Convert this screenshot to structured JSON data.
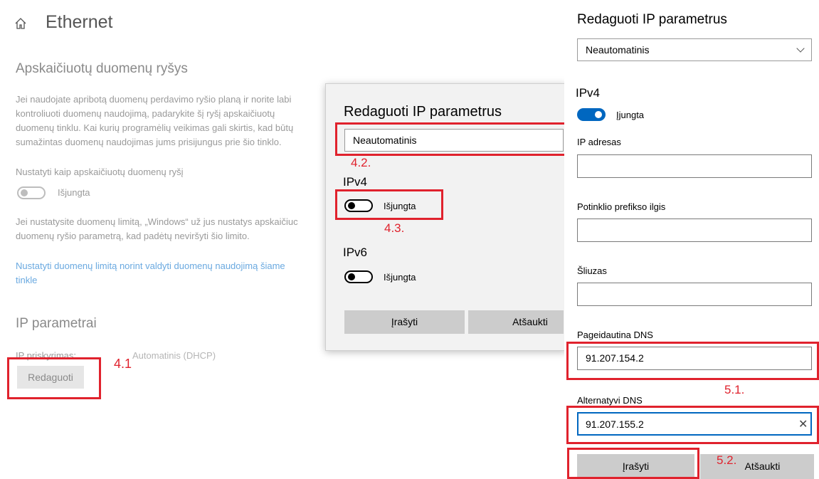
{
  "left": {
    "title": "Ethernet",
    "metered_heading": "Apskaičiuotų duomenų ryšys",
    "metered_desc": [
      "Jei naudojate apribotą duomenų perdavimo ryšio planą ir norite labi",
      "kontroliuoti duomenų naudojimą, padarykite šį ryšį apskaičiuotų",
      "duomenų tinklu. Kai kurių programėlių veikimas gali skirtis, kad būtų",
      "sumažintas duomenų naudojimas jums prisijungus prie šio tinklo."
    ],
    "set_metered_label": "Nustatyti kaip apskaičiuotų duomenų ryšį",
    "toggle_state": "Išjungta",
    "limit_desc": [
      "Jei nustatysite duomenų limitą, „Windows“ už jus nustatys apskaičiuc",
      "duomenų ryšio parametrą, kad padėtų neviršyti šio limito."
    ],
    "limit_link": [
      "Nustatyti duomenų limitą norint valdyti duomenų naudojimą šiame",
      "tinkle"
    ],
    "ip_heading": "IP parametrai",
    "ip_assign_label": "IP priskyrimas:",
    "ip_assign_value": "Automatinis (DHCP)",
    "edit_button": "Redaguoti",
    "annotation": "4.1"
  },
  "dialog": {
    "title": "Redaguoti IP parametrus",
    "mode_value": "Neautomatinis",
    "ipv4_label": "IPv4",
    "ipv4_state": "Išjungta",
    "ipv6_label": "IPv6",
    "ipv6_state": "Išjungta",
    "save_button": "Įrašyti",
    "cancel_button": "Atšaukti",
    "annotation_mode": "4.2.",
    "annotation_ipv4": "4.3."
  },
  "right": {
    "title": "Redaguoti IP parametrus",
    "mode_value": "Neautomatinis",
    "ipv4_label": "IPv4",
    "ipv4_state": "Įjungta",
    "ip_address_label": "IP adresas",
    "ip_address_value": "",
    "prefix_label": "Potinklio prefikso ilgis",
    "prefix_value": "",
    "gateway_label": "Šliuzas",
    "gateway_value": "",
    "preferred_dns_label": "Pageidautina DNS",
    "preferred_dns_value": "91.207.154.2",
    "alternate_dns_label": "Alternatyvi DNS",
    "alternate_dns_value": "91.207.155.2",
    "save_button": "Įrašyti",
    "cancel_button": "Atšaukti",
    "annotation_dns": "5.1.",
    "annotation_save": "5.2."
  },
  "colors": {
    "accent": "#0067c0",
    "annotation": "#e0222d",
    "link": "#6aa9e0"
  },
  "icons": {
    "home": "home-icon",
    "chevron": "chevron-down-icon",
    "clear": "clear-icon"
  }
}
